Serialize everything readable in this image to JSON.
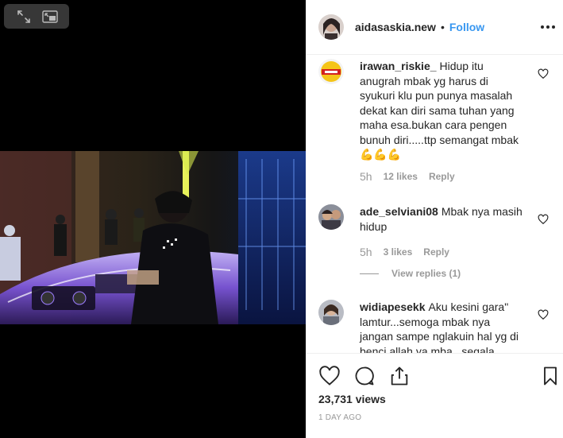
{
  "post": {
    "username": "aidasaskia.new",
    "separator": "•",
    "follow_label": "Follow"
  },
  "icons": {
    "pip_fullscreen": "expand-arrows-icon",
    "pip_exit": "picture-in-picture-icon",
    "more": "more-options-icon",
    "like": "heart-icon",
    "comment": "comment-icon",
    "share": "share-icon",
    "save": "bookmark-icon"
  },
  "comments": [
    {
      "username": "irawan_riskie_",
      "text": "Hidup itu anugrah mbak yg harus di syukuri klu pun punya masalah dekat kan diri sama tuhan yang maha esa.bukan cara pengen bunuh diri.....ttp semangat mbak 💪💪💪",
      "time": "5h",
      "likes": "12 likes",
      "reply": "Reply"
    },
    {
      "username": "ade_selviani08",
      "text": "Mbak nya masih hidup",
      "time": "5h",
      "likes": "3 likes",
      "reply": "Reply",
      "view_replies": "View replies (1)"
    },
    {
      "username": "widiapesekk",
      "text": "Aku kesini gara\" lamtur...semoga mbak nya jangan sampe nglakuin hal yg di benci allah ya mba.. segala"
    }
  ],
  "footer": {
    "views": "23,731 views",
    "time_ago": "1 DAY AGO"
  },
  "colors": {
    "link": "#3897f0",
    "text": "#262626",
    "muted": "#999999",
    "border": "#efefef"
  }
}
